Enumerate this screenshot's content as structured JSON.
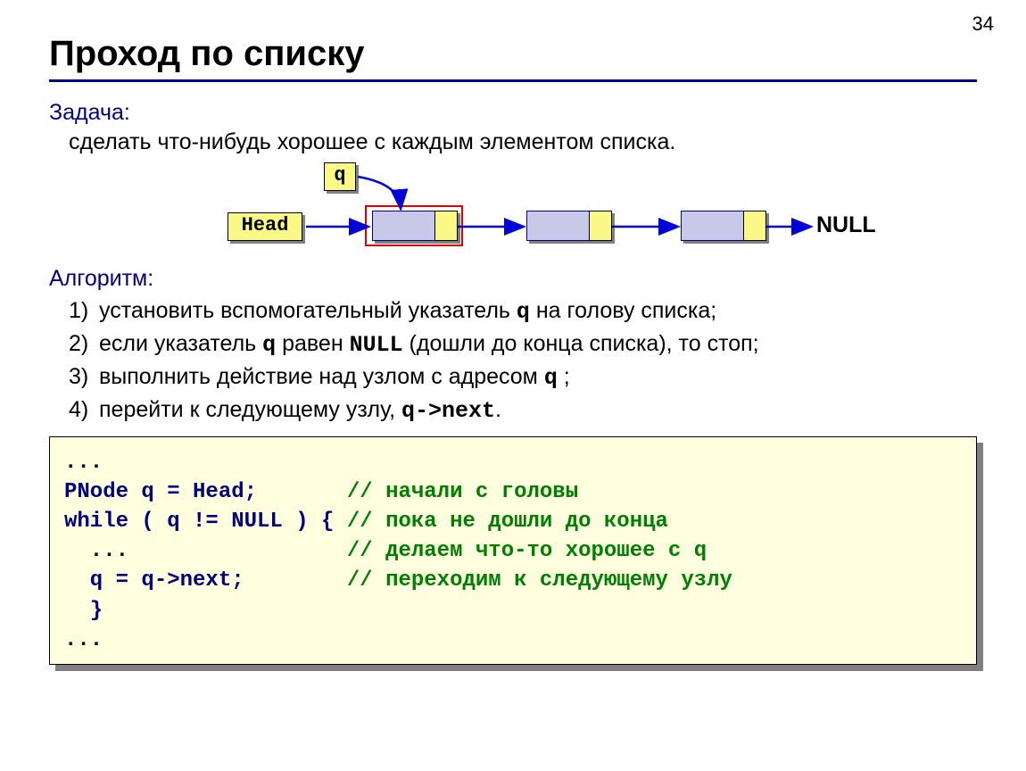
{
  "page_number": "34",
  "title": "Проход по списку",
  "task": {
    "label": "Задача:",
    "text": "сделать что-нибудь хорошее с каждым элементом списка."
  },
  "diagram": {
    "q_label": "q",
    "head_label": "Head",
    "null_label": "NULL",
    "nodes": 3
  },
  "algorithm": {
    "label": "Алгоритм:",
    "items": [
      {
        "num": "1)",
        "before": "установить вспомогательный указатель ",
        "mono": "q",
        "after": " на голову списка;"
      },
      {
        "num": "2)",
        "before": "если указатель ",
        "mono": "q",
        "mid": " равен ",
        "mono2": "NULL",
        "after": " (дошли до конца списка), то стоп;"
      },
      {
        "num": "3)",
        "before": "выполнить действие над узлом с адресом ",
        "mono": "q",
        "after": " ;"
      },
      {
        "num": "4)",
        "before": "перейти к следующему узлу, ",
        "mono": "q->next",
        "after": "."
      }
    ]
  },
  "code": {
    "lines": [
      {
        "parts": [
          {
            "cls": "plain",
            "t": "..."
          }
        ]
      },
      {
        "parts": [
          {
            "cls": "kw",
            "t": "PNode q = Head;       "
          },
          {
            "cls": "cmt",
            "t": "// начали с головы"
          }
        ]
      },
      {
        "parts": [
          {
            "cls": "kw",
            "t": "while ( q != NULL ) { "
          },
          {
            "cls": "cmt",
            "t": "// пока не дошли до конца"
          }
        ]
      },
      {
        "parts": [
          {
            "cls": "plain",
            "t": "  ...                 "
          },
          {
            "cls": "cmt",
            "t": "// делаем что-то хорошее с q"
          }
        ]
      },
      {
        "parts": [
          {
            "cls": "kw",
            "t": "  q = q->next;        "
          },
          {
            "cls": "cmt",
            "t": "// переходим к следующему узлу"
          }
        ]
      },
      {
        "parts": [
          {
            "cls": "kw",
            "t": "  }"
          }
        ]
      },
      {
        "parts": [
          {
            "cls": "plain",
            "t": "..."
          }
        ]
      }
    ]
  }
}
